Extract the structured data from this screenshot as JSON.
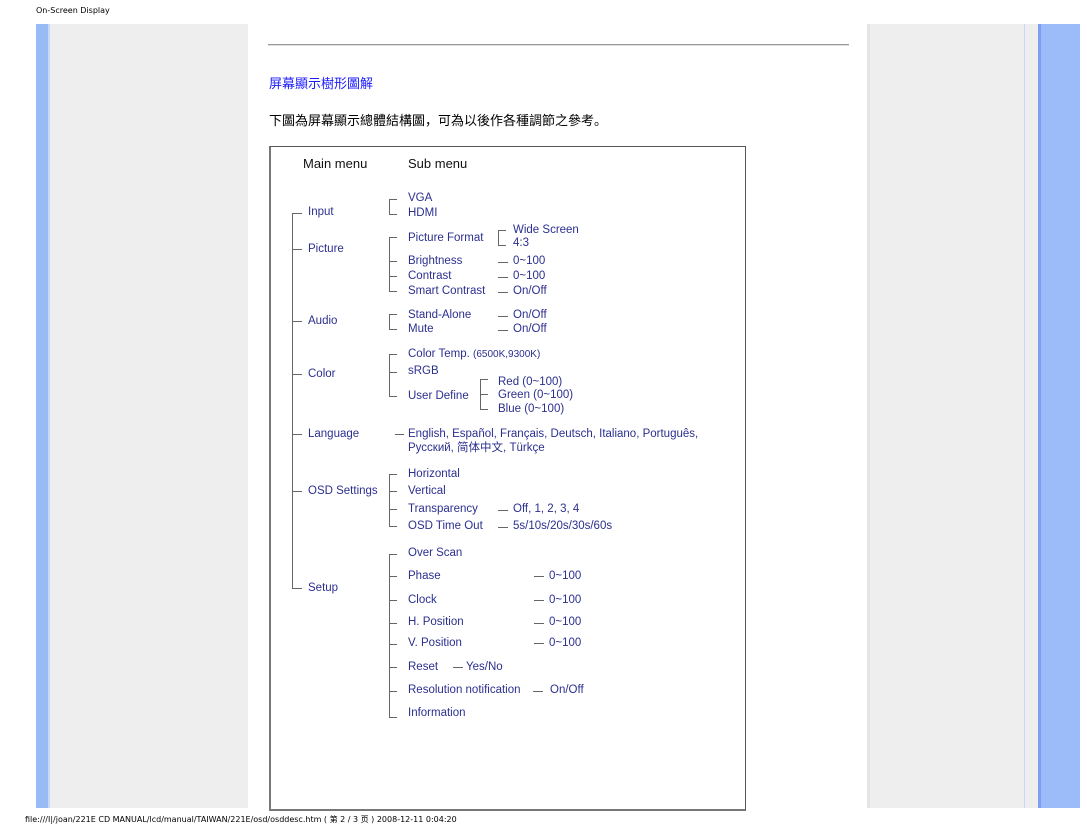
{
  "header": {
    "label": "On-Screen Display"
  },
  "section": {
    "title": "屏幕顯示樹形圖解",
    "intro": "下圖為屏幕顯示總體結構圖，可為以後作各種調節之參考。"
  },
  "diagram": {
    "headers": {
      "main": "Main menu",
      "sub": "Sub menu"
    },
    "input": {
      "label": "Input",
      "items": [
        "VGA",
        "HDMI"
      ]
    },
    "picture": {
      "label": "Picture",
      "format": {
        "label": "Picture Format",
        "options": [
          "Wide Screen",
          "4:3"
        ]
      },
      "brightness": {
        "label": "Brightness",
        "value": "0~100"
      },
      "contrast": {
        "label": "Contrast",
        "value": "0~100"
      },
      "smart_contrast": {
        "label": "Smart Contrast",
        "value": "On/Off"
      }
    },
    "audio": {
      "label": "Audio",
      "standalone": {
        "label": "Stand-Alone",
        "value": "On/Off"
      },
      "mute": {
        "label": "Mute",
        "value": "On/Off"
      }
    },
    "color": {
      "label": "Color",
      "temp": {
        "label": "Color Temp.",
        "value": "(6500K,9300K)"
      },
      "srgb": "sRGB",
      "user_define": {
        "label": "User Define",
        "options": [
          "Red (0~100)",
          "Green (0~100)",
          "Blue (0~100)"
        ]
      }
    },
    "language": {
      "label": "Language",
      "line1": "English, Español, Français, Deutsch, Italiano, Português,",
      "line2": "Русский, 简体中文, Türkçe"
    },
    "osd": {
      "label": "OSD Settings",
      "horizontal": "Horizontal",
      "vertical": "Vertical",
      "transparency": {
        "label": "Transparency",
        "value": "Off, 1, 2, 3, 4"
      },
      "timeout": {
        "label": "OSD Time Out",
        "value": "5s/10s/20s/30s/60s"
      }
    },
    "setup": {
      "label": "Setup",
      "overscan": "Over Scan",
      "phase": {
        "label": "Phase",
        "value": "0~100"
      },
      "clock": {
        "label": "Clock",
        "value": "0~100"
      },
      "hpos": {
        "label": "H. Position",
        "value": "0~100"
      },
      "vpos": {
        "label": "V. Position",
        "value": "0~100"
      },
      "reset": {
        "label": "Reset",
        "value": "Yes/No"
      },
      "resnotif": {
        "label": "Resolution notification",
        "value": "On/Off"
      },
      "information": "Information"
    }
  },
  "footer": {
    "path": "file:///I|/joan/221E CD MANUAL/lcd/manual/TAIWAN/221E/osd/osddesc.htm ( 第 2 / 3 页 ) 2008-12-11 0:04:20"
  }
}
